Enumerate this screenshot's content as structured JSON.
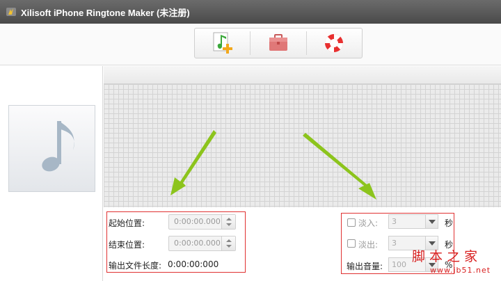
{
  "window": {
    "title": "Xilisoft iPhone Ringtone Maker (未注册)"
  },
  "toolbar": {
    "add_file": "add-music-file-icon",
    "toolbox": "toolbox-icon",
    "help": "lifebuoy-help-icon"
  },
  "position": {
    "start_label": "起始位置:",
    "start_value": "0:00:00.000",
    "end_label": "结束位置:",
    "end_value": "0:00:00.000",
    "length_label": "输出文件长度:",
    "length_value": "0:00:00:000"
  },
  "fade": {
    "fade_in_label": "淡入:",
    "fade_in_value": "3",
    "fade_out_label": "淡出:",
    "fade_out_value": "3",
    "unit": "秒",
    "volume_label": "输出音量:",
    "volume_value": "100",
    "volume_unit": "%"
  },
  "watermark": {
    "line1": "脚 本 之 家",
    "line2": "www.jb51.net"
  },
  "colors": {
    "highlight_box": "#e03030",
    "arrow": "#8cc41c"
  }
}
